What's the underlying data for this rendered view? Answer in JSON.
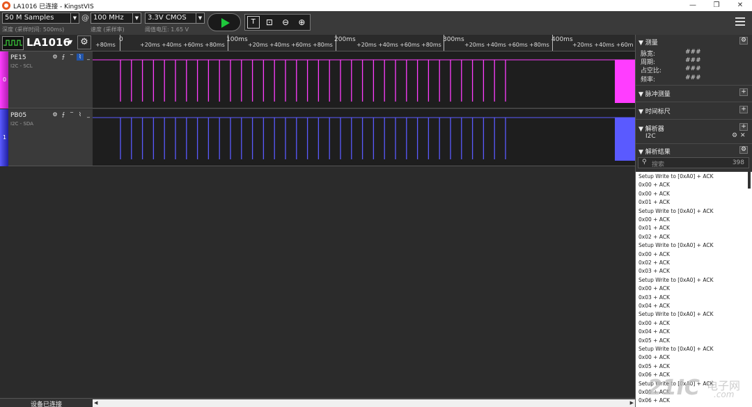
{
  "window": {
    "title": "LA1016 已连接 - KingstVIS",
    "min_glyph": "—",
    "restore_glyph": "❐",
    "close_glyph": "✕",
    "dropdown_glyph": "▼"
  },
  "toolbar": {
    "samples": "50 M Samples",
    "samples_caption": "深度 (采样时间: 500ms)",
    "at_symbol": "@",
    "rate": "100 MHz",
    "rate_caption": "速度 (采样率)",
    "threshold": "3.3V CMOS",
    "threshold_caption": "阈值电压: 1.65 V",
    "text_tool_glyph": "T",
    "zoom_fit_glyph": "⊡",
    "zoom_out_glyph": "⊖",
    "zoom_in_glyph": "⊕"
  },
  "device": {
    "name": "LA1016",
    "dropdown": "▼",
    "gear": "⚙"
  },
  "timeline": {
    "major": [
      "0",
      "100ms",
      "200ms",
      "300ms",
      "400ms"
    ],
    "minor_left": "+80ms",
    "minor_labels": [
      "+20ms",
      "+40ms",
      "+60ms",
      "+80ms"
    ],
    "minor_right": "+20ms +40ms +60m"
  },
  "channels": [
    {
      "index": "0",
      "name": "PE15",
      "sub": "I2C - SCL",
      "color": "#ff3dff",
      "icons": [
        "⚙",
        "⨍",
        "‾",
        "⌇",
        "_"
      ]
    },
    {
      "index": "1",
      "name": "PB05",
      "sub": "I2C - SDA",
      "color": "#5a5aff",
      "icons": [
        "⚙",
        "⨍",
        "‾",
        "⌇",
        "_"
      ]
    }
  ],
  "panel": {
    "measure": {
      "title": "▼ 测量",
      "rows": [
        {
          "label": "脉宽:",
          "value": "###"
        },
        {
          "label": "周期:",
          "value": "###"
        },
        {
          "label": "占空比:",
          "value": "###"
        },
        {
          "label": "频率:",
          "value": "###"
        }
      ]
    },
    "pulse": "▼ 脉冲测量",
    "ruler": "▼ 时间标尺",
    "analyzer": "▼ 解析器",
    "analyzer_item": "I2C",
    "analyzer_item_close": "✕",
    "results": "▼ 解析结果",
    "search_placeholder": "搜索",
    "search_icon": "⚲",
    "result_count": "398",
    "plus": "+",
    "gear": "⚙",
    "result_rows": [
      "Setup Write to [0xA0] + ACK",
      "0x00 + ACK",
      "0x00 + ACK",
      "0x01 + ACK",
      "Setup Write to [0xA0] + ACK",
      "0x00 + ACK",
      "0x01 + ACK",
      "0x02 + ACK",
      "Setup Write to [0xA0] + ACK",
      "0x00 + ACK",
      "0x02 + ACK",
      "0x03 + ACK",
      "Setup Write to [0xA0] + ACK",
      "0x00 + ACK",
      "0x03 + ACK",
      "0x04 + ACK",
      "Setup Write to [0xA0] + ACK",
      "0x00 + ACK",
      "0x04 + ACK",
      "0x05 + ACK",
      "Setup Write to [0xA0] + ACK",
      "0x00 + ACK",
      "0x05 + ACK",
      "0x06 + ACK",
      "Setup Write to [0xA0] + ACK",
      "0x00 + ACK",
      "0x06 + ACK"
    ]
  },
  "status": {
    "text": "设备已连接",
    "scroll_left": "◀",
    "scroll_right": "▶"
  },
  "watermark": {
    "main": "21IC",
    "cn": "电子网",
    "com": ".com"
  }
}
